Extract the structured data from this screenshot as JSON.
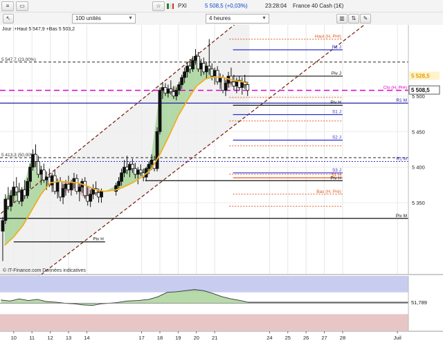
{
  "toolbar": {
    "quote": {
      "symbol": "PXI",
      "last": "5 508,5",
      "change": "(+0,03%)",
      "time": "23:28:04",
      "name": "France 40 Cash (1€)"
    },
    "units_select": "100 unités",
    "timeframe_select": "4 heures"
  },
  "chart_data": [
    {
      "type": "candlestick",
      "header": "Jour :+Haut 5 547,9 +Bas 5 503,2",
      "source": "© IT-Finance.com  Données indicatives",
      "y_range": [
        5250,
        5600
      ],
      "x_range": [
        9.25,
        31.6
      ],
      "y_ticks": [
        5350,
        5400,
        5450,
        5500
      ],
      "y_tick_labels": [
        "5 350",
        "5 400",
        "5 450",
        "5 500"
      ],
      "x_ticks": [
        10,
        11,
        12,
        13,
        14,
        17,
        18,
        19,
        20,
        21,
        24,
        25,
        26,
        27,
        28,
        31
      ],
      "x_tick_labels": [
        "10",
        "11",
        "12",
        "13",
        "14",
        "17",
        "18",
        "19",
        "20",
        "21",
        "24",
        "25",
        "26",
        "27",
        "28",
        "Juil"
      ],
      "last_price": "5 508,5",
      "last_price_value": 5508.5,
      "bid_price": "5 528,5",
      "bid_price_value": 5528.5,
      "candles": [
        [
          9.4,
          5310,
          5330,
          5268,
          5325
        ],
        [
          9.55,
          5325,
          5362,
          5320,
          5355
        ],
        [
          9.7,
          5355,
          5372,
          5340,
          5345
        ],
        [
          9.85,
          5345,
          5368,
          5338,
          5360
        ],
        [
          10.0,
          5360,
          5380,
          5350,
          5372
        ],
        [
          10.15,
          5372,
          5386,
          5360,
          5365
        ],
        [
          10.3,
          5365,
          5378,
          5348,
          5352
        ],
        [
          10.45,
          5352,
          5372,
          5345,
          5368
        ],
        [
          10.6,
          5368,
          5382,
          5355,
          5360
        ],
        [
          10.75,
          5360,
          5385,
          5356,
          5380
        ],
        [
          10.9,
          5380,
          5405,
          5370,
          5400
        ],
        [
          11.05,
          5400,
          5425,
          5395,
          5418
        ],
        [
          11.2,
          5418,
          5432,
          5400,
          5408
        ],
        [
          11.35,
          5408,
          5416,
          5385,
          5390
        ],
        [
          11.5,
          5390,
          5402,
          5375,
          5396
        ],
        [
          11.65,
          5396,
          5405,
          5378,
          5382
        ],
        [
          11.8,
          5382,
          5394,
          5368,
          5386
        ],
        [
          11.95,
          5386,
          5398,
          5372,
          5375
        ],
        [
          12.1,
          5375,
          5392,
          5365,
          5388
        ],
        [
          12.25,
          5388,
          5396,
          5362,
          5366
        ],
        [
          12.4,
          5366,
          5384,
          5356,
          5380
        ],
        [
          12.55,
          5380,
          5386,
          5352,
          5358
        ],
        [
          12.7,
          5358,
          5376,
          5348,
          5370
        ],
        [
          12.85,
          5370,
          5382,
          5360,
          5376
        ],
        [
          13.0,
          5376,
          5388,
          5364,
          5368
        ],
        [
          13.15,
          5368,
          5382,
          5360,
          5378
        ],
        [
          13.3,
          5378,
          5392,
          5370,
          5384
        ],
        [
          13.45,
          5384,
          5390,
          5362,
          5366
        ],
        [
          13.6,
          5366,
          5378,
          5352,
          5372
        ],
        [
          13.75,
          5372,
          5384,
          5364,
          5380
        ],
        [
          13.9,
          5380,
          5386,
          5356,
          5360
        ],
        [
          14.05,
          5360,
          5372,
          5346,
          5352
        ],
        [
          14.2,
          5352,
          5368,
          5344,
          5362
        ],
        [
          14.35,
          5362,
          5376,
          5355,
          5370
        ],
        [
          14.5,
          5370,
          5380,
          5360,
          5364
        ],
        [
          14.65,
          5364,
          5370,
          5350,
          5358
        ],
        [
          14.8,
          5358,
          5370,
          5350,
          5366
        ],
        [
          15.6,
          5366,
          5378,
          5360,
          5374
        ],
        [
          15.75,
          5374,
          5386,
          5368,
          5380
        ],
        [
          15.9,
          5380,
          5398,
          5374,
          5392
        ],
        [
          16.05,
          5392,
          5410,
          5386,
          5400
        ],
        [
          16.2,
          5400,
          5416,
          5390,
          5396
        ],
        [
          16.35,
          5396,
          5408,
          5386,
          5404
        ],
        [
          16.5,
          5404,
          5412,
          5392,
          5398
        ],
        [
          16.65,
          5398,
          5406,
          5384,
          5390
        ],
        [
          16.8,
          5390,
          5400,
          5376,
          5396
        ],
        [
          16.95,
          5396,
          5404,
          5388,
          5392
        ],
        [
          17.1,
          5392,
          5398,
          5380,
          5386
        ],
        [
          17.25,
          5386,
          5400,
          5380,
          5398
        ],
        [
          17.4,
          5398,
          5408,
          5390,
          5404
        ],
        [
          17.55,
          5404,
          5418,
          5396,
          5410
        ],
        [
          17.7,
          5410,
          5416,
          5394,
          5398
        ],
        [
          17.85,
          5398,
          5456,
          5394,
          5450
        ],
        [
          18.0,
          5450,
          5512,
          5446,
          5508
        ],
        [
          18.15,
          5508,
          5520,
          5496,
          5512
        ],
        [
          18.3,
          5512,
          5518,
          5500,
          5504
        ],
        [
          18.45,
          5504,
          5516,
          5498,
          5510
        ],
        [
          18.6,
          5510,
          5522,
          5502,
          5506
        ],
        [
          18.75,
          5506,
          5514,
          5496,
          5500
        ],
        [
          18.9,
          5500,
          5512,
          5494,
          5508
        ],
        [
          19.05,
          5508,
          5520,
          5502,
          5516
        ],
        [
          19.2,
          5516,
          5530,
          5510,
          5526
        ],
        [
          19.35,
          5526,
          5540,
          5518,
          5534
        ],
        [
          19.5,
          5534,
          5548,
          5526,
          5542
        ],
        [
          19.65,
          5542,
          5552,
          5532,
          5538
        ],
        [
          19.8,
          5538,
          5556,
          5534,
          5550
        ],
        [
          19.95,
          5550,
          5566,
          5544,
          5556
        ],
        [
          20.1,
          5556,
          5562,
          5534,
          5538
        ],
        [
          20.25,
          5538,
          5552,
          5528,
          5546
        ],
        [
          20.4,
          5546,
          5554,
          5530,
          5534
        ],
        [
          20.55,
          5534,
          5548,
          5524,
          5542
        ],
        [
          20.7,
          5542,
          5580,
          5530,
          5538
        ],
        [
          20.85,
          5538,
          5546,
          5522,
          5528
        ],
        [
          21.0,
          5528,
          5540,
          5516,
          5536
        ],
        [
          21.15,
          5536,
          5542,
          5516,
          5520
        ],
        [
          21.3,
          5520,
          5532,
          5510,
          5526
        ],
        [
          21.45,
          5526,
          5530,
          5504,
          5508
        ],
        [
          21.6,
          5508,
          5522,
          5500,
          5518
        ],
        [
          21.75,
          5518,
          5534,
          5512,
          5528
        ],
        [
          21.9,
          5528,
          5540,
          5516,
          5520
        ],
        [
          22.05,
          5520,
          5530,
          5508,
          5514
        ],
        [
          22.2,
          5514,
          5526,
          5504,
          5522
        ],
        [
          22.35,
          5522,
          5528,
          5508,
          5512
        ],
        [
          22.5,
          5512,
          5526,
          5502,
          5520
        ],
        [
          22.65,
          5520,
          5530,
          5510,
          5516
        ],
        [
          22.8,
          5516,
          5520,
          5500,
          5508
        ]
      ],
      "moving_average": [
        [
          9.5,
          5290
        ],
        [
          10.0,
          5302
        ],
        [
          10.5,
          5318
        ],
        [
          11.0,
          5340
        ],
        [
          11.5,
          5362
        ],
        [
          12.0,
          5378
        ],
        [
          12.5,
          5380
        ],
        [
          13.0,
          5379
        ],
        [
          13.5,
          5378
        ],
        [
          14.0,
          5374
        ],
        [
          14.5,
          5368
        ],
        [
          15.0,
          5366
        ],
        [
          15.6,
          5368
        ],
        [
          16.0,
          5372
        ],
        [
          16.5,
          5378
        ],
        [
          17.0,
          5386
        ],
        [
          17.5,
          5396
        ],
        [
          18.0,
          5418
        ],
        [
          18.5,
          5444
        ],
        [
          19.0,
          5472
        ],
        [
          19.5,
          5494
        ],
        [
          20.0,
          5514
        ],
        [
          20.5,
          5524
        ],
        [
          21.0,
          5527
        ],
        [
          21.5,
          5526
        ],
        [
          22.0,
          5522
        ],
        [
          22.5,
          5520
        ],
        [
          22.8,
          5518
        ]
      ],
      "channel_upper": [
        [
          9.3,
          5335
        ],
        [
          31.6,
          5798
        ]
      ],
      "channel_lower": [
        [
          10.3,
          5225
        ],
        [
          31.6,
          5648
        ]
      ],
      "levels": [
        {
          "label": "5 547,7 (23,00%)",
          "value": 5547.7,
          "style": "dashed",
          "color": "#222222",
          "x_from": 9.25
        },
        {
          "label": "5 413,3 (50,00%)",
          "value": 5413.3,
          "style": "dashed",
          "color": "#222222",
          "x_from": 9.25
        },
        {
          "label": "Haut (H, Pré)",
          "value": 5580,
          "style": "dotted",
          "color": "#e05a1e",
          "x_from": 21.8
        },
        {
          "label": "Clo (H, Pré)",
          "value": 5508,
          "style": "dashed",
          "color": "#e000c8",
          "x_from": 9.25
        },
        {
          "label": "R1 J",
          "value": 5565,
          "style": "solid",
          "color": "#2f2fd0",
          "x_from": 22.0
        },
        {
          "label": "Piv J",
          "value": 5528,
          "style": "solid",
          "color": "#111111",
          "x_from": 22.0
        },
        {
          "label": "R1 M",
          "value": 5490,
          "style": "solid",
          "color": "#1a1aa8",
          "x_from": 9.25
        },
        {
          "label": "Piv H",
          "value": 5487,
          "style": "solid",
          "color": "#111111",
          "x_from": 22.0
        },
        {
          "label": "S1 J",
          "value": 5474,
          "style": "solid",
          "color": "#2f2fd0",
          "x_from": 22.0
        },
        {
          "label": "S2 J",
          "value": 5438,
          "style": "solid",
          "color": "#2f2fd0",
          "x_from": 22.0
        },
        {
          "label": "R1 M",
          "value": 5408,
          "style": "dotted",
          "color": "#2f2fd0",
          "x_from": 9.25
        },
        {
          "label": "S3 J",
          "value": 5392,
          "style": "solid",
          "color": "#2f2fd0",
          "x_from": 22.0
        },
        {
          "label": "S1 H",
          "value": 5385,
          "style": "solid",
          "color": "#e05a1e",
          "x_from": 22.0
        },
        {
          "label": "Piv H",
          "value": 5381,
          "style": "solid",
          "color": "#111111",
          "x_from": 17.2
        },
        {
          "label": "Bas (H, Pré)",
          "value": 5362,
          "style": "dotted",
          "color": "#e05a1e",
          "x_from": 22.0
        },
        {
          "label": "Piv M",
          "value": 5328,
          "style": "solid",
          "color": "#111111",
          "x_from": 9.25
        },
        {
          "label": "Piv H",
          "value": 5295,
          "style": "solid",
          "color": "#111111",
          "x_from": 10.0,
          "x_to": 15.0
        }
      ],
      "extra_dotted_levels": [
        5498,
        5465,
        5430,
        5390,
        5345
      ]
    },
    {
      "type": "oscillator",
      "value_label": "51,789",
      "last_value": 51.789,
      "y_range": [
        0,
        100
      ],
      "upper_band": [
        70,
        100
      ],
      "lower_band": [
        0,
        30
      ],
      "midline": 50,
      "values": [
        [
          9.3,
          56
        ],
        [
          9.8,
          54
        ],
        [
          10.3,
          58
        ],
        [
          10.8,
          55
        ],
        [
          11.3,
          57
        ],
        [
          11.8,
          53
        ],
        [
          12.3,
          52
        ],
        [
          12.8,
          50
        ],
        [
          13.3,
          49
        ],
        [
          13.8,
          47
        ],
        [
          14.3,
          46
        ],
        [
          14.8,
          49
        ],
        [
          15.6,
          51
        ],
        [
          16.2,
          54
        ],
        [
          16.8,
          55
        ],
        [
          17.4,
          57
        ],
        [
          17.9,
          62
        ],
        [
          18.4,
          70
        ],
        [
          18.9,
          71
        ],
        [
          19.4,
          73
        ],
        [
          19.9,
          75
        ],
        [
          20.4,
          73
        ],
        [
          20.9,
          68
        ],
        [
          21.4,
          62
        ],
        [
          21.9,
          58
        ],
        [
          22.4,
          55
        ],
        [
          22.8,
          52
        ]
      ]
    }
  ]
}
